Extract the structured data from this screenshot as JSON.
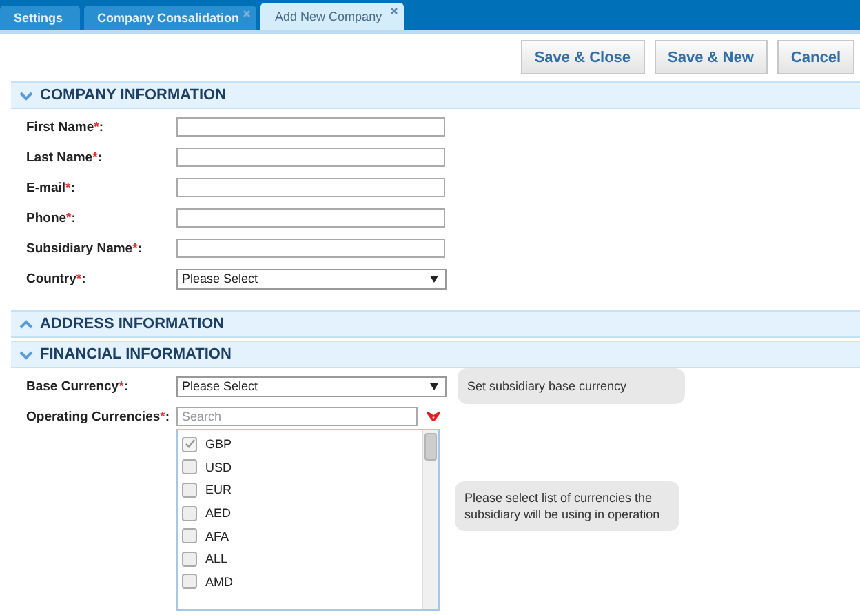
{
  "tabs": [
    {
      "label": "Settings",
      "selected": false,
      "closable": false
    },
    {
      "label": "Company Consalidation",
      "selected": false,
      "closable": true
    },
    {
      "label": "Add New Company",
      "selected": true,
      "closable": true
    }
  ],
  "buttons": [
    "Save & Close",
    "Save & New",
    "Cancel"
  ],
  "sections": [
    {
      "title": "COMPANY INFORMATION",
      "expanded": true,
      "fields": [
        {
          "kind": "text",
          "label": "First Name",
          "required": true,
          "mark": "*",
          "colon": ":"
        },
        {
          "kind": "text",
          "label": "Last Name",
          "required": true,
          "mark": "*",
          "colon": ":"
        },
        {
          "kind": "text",
          "label": "E-mail",
          "required": true,
          "mark": "*",
          "colon": ":"
        },
        {
          "kind": "text",
          "label": "Phone",
          "required": true,
          "mark": "*",
          "colon": ":"
        },
        {
          "kind": "text",
          "label": "Subsidiary Name",
          "required": true,
          "mark": "*",
          "colon": ":"
        },
        {
          "kind": "select",
          "label": "Country",
          "required": true,
          "mark": "*",
          "colon": ":",
          "value": "Please Select"
        }
      ]
    },
    {
      "title": "ADDRESS INFORMATION",
      "expanded": false
    },
    {
      "title": "FINANCIAL INFORMATION",
      "expanded": true,
      "fields": [
        {
          "kind": "select",
          "label": "Base Currency",
          "required": true,
          "mark": "*",
          "colon": ":",
          "value": "Please Select",
          "hint": "Set subsidiary base currency"
        },
        {
          "kind": "multi",
          "label": "Operating Currencies",
          "required": true,
          "mark": "*",
          "colon": ":",
          "placeholder": "Search",
          "hint": "Please select list of currencies the subsidiary will be using in operation",
          "options": [
            {
              "label": "GBP",
              "checked": true
            },
            {
              "label": "USD",
              "checked": false
            },
            {
              "label": "EUR",
              "checked": false
            },
            {
              "label": "AED",
              "checked": false
            },
            {
              "label": "AFA",
              "checked": false
            },
            {
              "label": "ALL",
              "checked": false
            },
            {
              "label": "AMD",
              "checked": false
            }
          ]
        }
      ]
    }
  ]
}
